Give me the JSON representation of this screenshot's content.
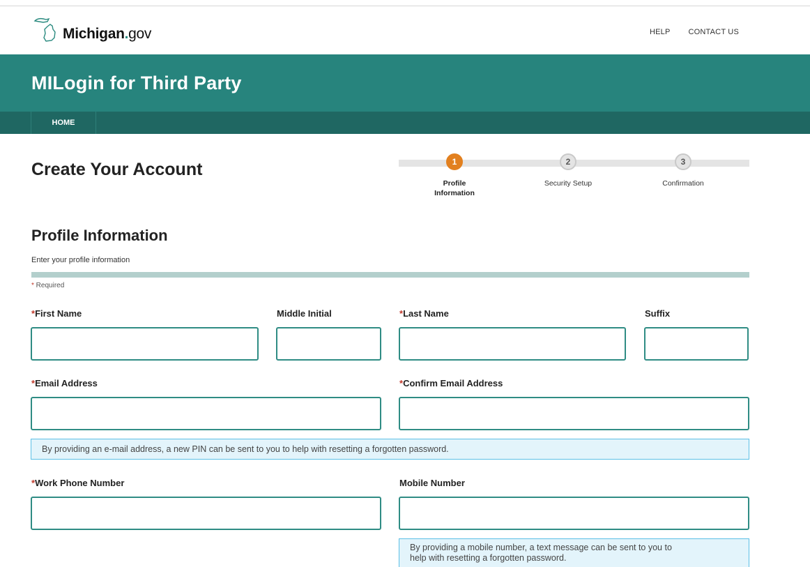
{
  "header": {
    "logo_name": "Michigan",
    "logo_dot": ".",
    "logo_suffix": "gov",
    "links": {
      "help": "HELP",
      "contact": "CONTACT US"
    },
    "banner_title": "MILogin for Third Party",
    "nav": {
      "home": "HOME"
    }
  },
  "page": {
    "title": "Create Your Account",
    "steps": [
      {
        "number": "1",
        "label_line1": "Profile",
        "label_line2": "Information",
        "state": "active"
      },
      {
        "number": "2",
        "label_line1": "Security Setup",
        "label_line2": "",
        "state": "pending"
      },
      {
        "number": "3",
        "label_line1": "Confirmation",
        "label_line2": "",
        "state": "pending"
      }
    ]
  },
  "section": {
    "title": "Profile Information",
    "description": "Enter your profile information",
    "required_marker": "*",
    "required_text": " Required"
  },
  "form": {
    "first_name": {
      "label": "First Name",
      "required": "*",
      "value": ""
    },
    "middle_initial": {
      "label": "Middle Initial",
      "value": ""
    },
    "last_name": {
      "label": "Last Name",
      "required": "*",
      "value": ""
    },
    "suffix": {
      "label": "Suffix",
      "value": ""
    },
    "email": {
      "label": "Email Address",
      "required": "*",
      "value": ""
    },
    "confirm_email": {
      "label": "Confirm Email Address",
      "required": "*",
      "value": ""
    },
    "email_hint": "By providing an e-mail address, a new PIN can be sent to you to help with resetting a forgotten password.",
    "work_phone": {
      "label": "Work Phone Number",
      "required": "*",
      "value": ""
    },
    "mobile": {
      "label": "Mobile Number",
      "value": ""
    },
    "mobile_hint_line1": "By providing a mobile number, a text message can be sent to you to",
    "mobile_hint_line2": "help with resetting a forgotten password."
  },
  "colors": {
    "banner": "#27847d",
    "nav": "#1f6762",
    "active_step": "#e2801f",
    "field_border": "#2f8c84",
    "hint_bg": "#e3f4fb",
    "hint_border": "#5cc0e6",
    "required": "#c0392b"
  }
}
